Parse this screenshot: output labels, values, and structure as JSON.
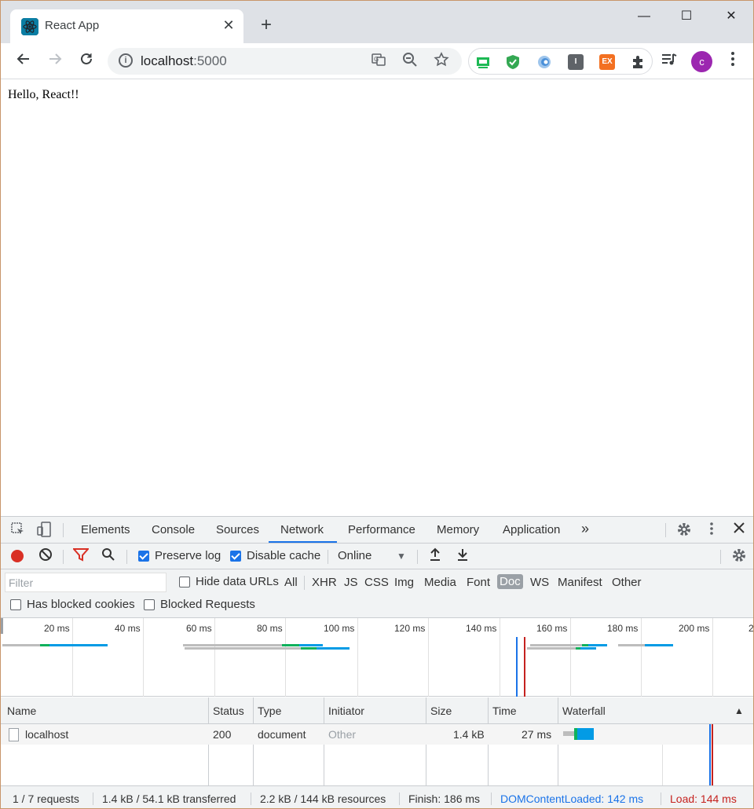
{
  "browser": {
    "tab_title": "React App",
    "tab_close": "✕",
    "new_tab": "+",
    "window_minimize": "—",
    "window_maximize": "☐",
    "window_close": "✕",
    "url_host": "localhost",
    "url_port": ":5000",
    "avatar_letter": "c",
    "extensions": [
      {
        "name": "extension-green-screen",
        "color": "#1db954"
      },
      {
        "name": "extension-shield",
        "color": "#34a853"
      },
      {
        "name": "extension-blue-circle",
        "color": "#4a90d9"
      },
      {
        "name": "extension-dark-i",
        "color": "#5f6368"
      },
      {
        "name": "extension-ex",
        "color": "#f37021"
      }
    ]
  },
  "page": {
    "text": "Hello, React!!"
  },
  "devtools": {
    "tabs": [
      "Elements",
      "Console",
      "Sources",
      "Network",
      "Performance",
      "Memory",
      "Application"
    ],
    "active_tab": "Network",
    "more_tabs": "»",
    "toolbar": {
      "preserve_log": "Preserve log",
      "preserve_log_checked": true,
      "disable_cache": "Disable cache",
      "disable_cache_checked": true,
      "throttling": "Online"
    },
    "filter": {
      "placeholder": "Filter",
      "hide_data_urls": "Hide data URLs",
      "types": [
        "All",
        "XHR",
        "JS",
        "CSS",
        "Img",
        "Media",
        "Font",
        "Doc",
        "WS",
        "Manifest",
        "Other"
      ],
      "active_type": "Doc",
      "has_blocked_cookies": "Has blocked cookies",
      "blocked_requests": "Blocked Requests"
    },
    "overview": {
      "ticks": [
        "20 ms",
        "40 ms",
        "60 ms",
        "80 ms",
        "100 ms",
        "120 ms",
        "140 ms",
        "160 ms",
        "180 ms",
        "200 ms"
      ]
    },
    "table": {
      "columns": [
        "Name",
        "Status",
        "Type",
        "Initiator",
        "Size",
        "Time",
        "Waterfall"
      ],
      "sort_indicator": "▲",
      "rows": [
        {
          "name": "localhost",
          "status": "200",
          "type": "document",
          "initiator": "Other",
          "size": "1.4 kB",
          "time": "27 ms"
        }
      ]
    },
    "status": {
      "requests": "1 / 7 requests",
      "transferred": "1.4 kB / 54.1 kB transferred",
      "resources": "2.2 kB / 144 kB resources",
      "finish": "Finish: 186 ms",
      "dom_content_loaded": "DOMContentLoaded: 142 ms",
      "load": "Load: 144 ms"
    },
    "colors": {
      "dom_content_loaded": "#1a73e8",
      "load": "#c5221f",
      "waiting": "#0fb15c",
      "download": "#039be5"
    }
  }
}
